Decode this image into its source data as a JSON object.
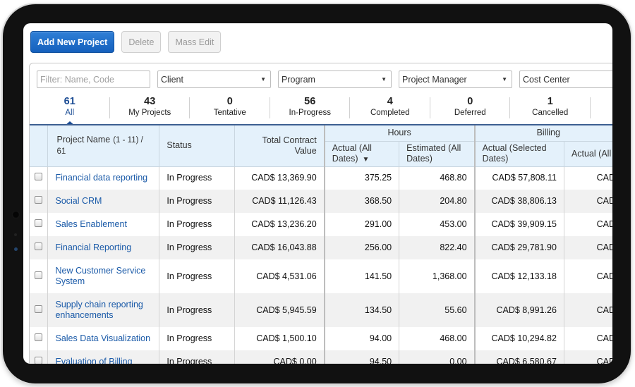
{
  "toolbar": {
    "add_label": "Add New Project",
    "delete_label": "Delete",
    "mass_edit_label": "Mass Edit"
  },
  "filters": {
    "search_placeholder": "Filter: Name, Code",
    "client": "Client",
    "program": "Program",
    "project_manager": "Project Manager",
    "cost_center": "Cost Center"
  },
  "status_tabs": [
    {
      "count": "61",
      "label": "All",
      "active": true
    },
    {
      "count": "43",
      "label": "My Projects"
    },
    {
      "count": "0",
      "label": "Tentative"
    },
    {
      "count": "56",
      "label": "In-Progress"
    },
    {
      "count": "4",
      "label": "Completed"
    },
    {
      "count": "0",
      "label": "Deferred"
    },
    {
      "count": "1",
      "label": "Cancelled"
    }
  ],
  "table": {
    "headers": {
      "project_name": "Project Name",
      "range": "(1 - 11) / 61",
      "status": "Status",
      "total_contract_value": "Total Contract Value",
      "hours_group": "Hours",
      "hours_actual": "Actual (All Dates)",
      "hours_estimated": "Estimated (All Dates)",
      "billing_group": "Billing",
      "billing_actual_selected": "Actual (Selected Dates)",
      "billing_actual_all": "Actual (All"
    },
    "sort_indicator": "▼",
    "rows": [
      {
        "name": "Financial data reporting",
        "status": "In Progress",
        "tcv": "CAD$ 13,369.90",
        "hours_actual": "375.25",
        "hours_est": "468.80",
        "bill_sel": "CAD$ 57,808.11",
        "bill_all": "CAD$"
      },
      {
        "name": "Social CRM",
        "status": "In Progress",
        "tcv": "CAD$ 11,126.43",
        "hours_actual": "368.50",
        "hours_est": "204.80",
        "bill_sel": "CAD$ 38,806.13",
        "bill_all": "CAD$"
      },
      {
        "name": "Sales Enablement",
        "status": "In Progress",
        "tcv": "CAD$ 13,236.20",
        "hours_actual": "291.00",
        "hours_est": "453.00",
        "bill_sel": "CAD$ 39,909.15",
        "bill_all": "CAD$"
      },
      {
        "name": "Financial Reporting",
        "status": "In Progress",
        "tcv": "CAD$ 16,043.88",
        "hours_actual": "256.00",
        "hours_est": "822.40",
        "bill_sel": "CAD$ 29,781.90",
        "bill_all": "CAD$"
      },
      {
        "name": "New Customer Service System",
        "status": "In Progress",
        "tcv": "CAD$ 4,531.06",
        "hours_actual": "141.50",
        "hours_est": "1,368.00",
        "bill_sel": "CAD$ 12,133.18",
        "bill_all": "CAD$"
      },
      {
        "name": "Supply chain reporting enhancements",
        "status": "In Progress",
        "tcv": "CAD$ 5,945.59",
        "hours_actual": "134.50",
        "hours_est": "55.60",
        "bill_sel": "CAD$ 8,991.26",
        "bill_all": "CAD$"
      },
      {
        "name": "Sales Data Visualization",
        "status": "In Progress",
        "tcv": "CAD$ 1,500.10",
        "hours_actual": "94.00",
        "hours_est": "468.00",
        "bill_sel": "CAD$ 10,294.82",
        "bill_all": "CAD$"
      },
      {
        "name": "Evaluation of Billing",
        "status": "In Progress",
        "tcv": "CAD$ 0.00",
        "hours_actual": "94.50",
        "hours_est": "0.00",
        "bill_sel": "CAD$ 6,580.67",
        "bill_all": "CAD$"
      }
    ]
  }
}
